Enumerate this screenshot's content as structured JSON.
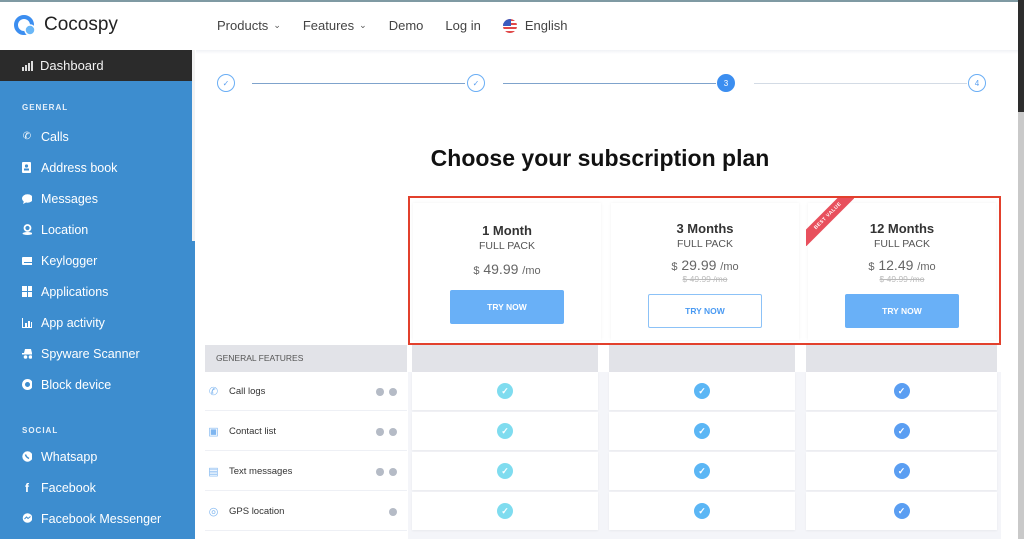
{
  "brand": {
    "name": "Cocospy"
  },
  "nav": {
    "items": [
      {
        "label": "Products",
        "dropdown": true
      },
      {
        "label": "Features",
        "dropdown": true
      },
      {
        "label": "Demo",
        "dropdown": false
      },
      {
        "label": "Log in",
        "dropdown": false
      }
    ],
    "language": "English"
  },
  "sidebar": {
    "dashboard": "Dashboard",
    "sections": [
      {
        "title": "GENERAL",
        "items": [
          {
            "label": "Calls",
            "icon": "phone-icon"
          },
          {
            "label": "Address book",
            "icon": "contact-card-icon"
          },
          {
            "label": "Messages",
            "icon": "chat-bubble-icon"
          },
          {
            "label": "Location",
            "icon": "location-pin-icon"
          },
          {
            "label": "Keylogger",
            "icon": "keyboard-icon"
          },
          {
            "label": "Applications",
            "icon": "apps-grid-icon"
          },
          {
            "label": "App activity",
            "icon": "bar-chart-icon"
          },
          {
            "label": "Spyware Scanner",
            "icon": "spy-icon"
          },
          {
            "label": "Block device",
            "icon": "block-circle-icon"
          }
        ]
      },
      {
        "title": "SOCIAL",
        "items": [
          {
            "label": "Whatsapp",
            "icon": "whatsapp-icon"
          },
          {
            "label": "Facebook",
            "icon": "facebook-icon"
          },
          {
            "label": "Facebook Messenger",
            "icon": "messenger-icon"
          }
        ]
      }
    ]
  },
  "stepper": {
    "steps": [
      {
        "label": "✓",
        "state": "done"
      },
      {
        "label": "✓",
        "state": "done"
      },
      {
        "label": "3",
        "state": "active"
      },
      {
        "label": "4",
        "state": "pending"
      }
    ]
  },
  "page": {
    "title": "Choose your subscription plan"
  },
  "plans": [
    {
      "name": "1 Month",
      "pack": "FULL PACK",
      "currency": "$",
      "price": "49.99",
      "period": "/mo",
      "old_price": "",
      "button": "TRY NOW",
      "button_style": "solid",
      "badge": ""
    },
    {
      "name": "3 Months",
      "pack": "FULL PACK",
      "currency": "$",
      "price": "29.99",
      "period": "/mo",
      "old_price": "$ 49.99 /mo",
      "button": "TRY NOW",
      "button_style": "outline",
      "badge": ""
    },
    {
      "name": "12 Months",
      "pack": "FULL PACK",
      "currency": "$",
      "price": "12.49",
      "period": "/mo",
      "old_price": "$ 49.99 /mo",
      "button": "TRY NOW",
      "button_style": "solid",
      "badge": "BEST VALUE"
    }
  ],
  "features": {
    "header": "GENERAL FEATURES",
    "rows": [
      {
        "label": "Call logs",
        "icon": "phone-icon",
        "ios": true,
        "android": true,
        "included": [
          true,
          true,
          true
        ]
      },
      {
        "label": "Contact list",
        "icon": "contact-card-icon",
        "ios": true,
        "android": true,
        "included": [
          true,
          true,
          true
        ]
      },
      {
        "label": "Text messages",
        "icon": "chat-bubble-icon",
        "ios": true,
        "android": true,
        "included": [
          true,
          true,
          true
        ]
      },
      {
        "label": "GPS location",
        "icon": "location-target-icon",
        "ios": false,
        "android": true,
        "included": [
          true,
          true,
          true
        ]
      }
    ],
    "check_colors": [
      "#7fdcef",
      "#5bb6f5",
      "#5a9ef2"
    ]
  },
  "colors": {
    "sidebar": "#3d8dcf",
    "accent": "#3c8ef0",
    "highlight_border": "#e2402c",
    "ribbon": "#e8505d"
  }
}
